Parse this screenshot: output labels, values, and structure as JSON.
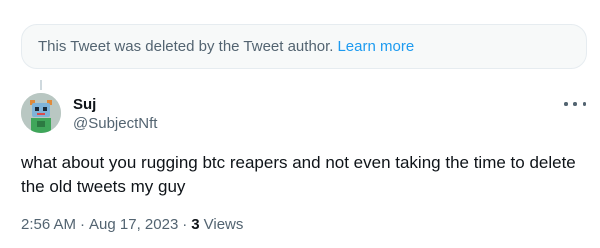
{
  "notice": {
    "text": "This Tweet was deleted by the Tweet author.",
    "link_label": "Learn more"
  },
  "author": {
    "name": "Suj",
    "handle": "@SubjectNft",
    "avatar_icon": "robot-avatar-icon"
  },
  "tweet": {
    "text": "what about you rugging btc reapers and not even taking the time to delete the old tweets my guy"
  },
  "meta": {
    "time": "2:56 AM",
    "separator": "·",
    "date": "Aug 17, 2023",
    "views_count": "3",
    "views_label": "Views"
  },
  "colors": {
    "link": "#1d9bf0",
    "secondary_text": "#536471",
    "primary_text": "#0f1419",
    "notice_bg": "#f7f9f9"
  }
}
